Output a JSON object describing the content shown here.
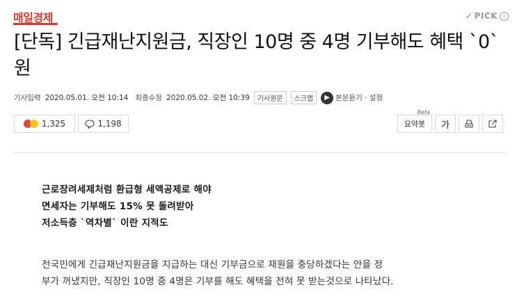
{
  "press": {
    "logo": "매일경제"
  },
  "pick": {
    "label": "PICK",
    "check": "✓",
    "info": "i"
  },
  "article": {
    "title": "[단독] 긴급재난지원금, 직장인 10명 중 4명 기부해도 혜택 `0`원",
    "meta": {
      "published_label": "기사입력",
      "published": "2020.05.01. 오전 10:14",
      "modified_label": "최종수정",
      "modified": "2020.05.02. 오전 10:39",
      "original_link": "기사원문",
      "scrap": "스크랩",
      "audio_label": "본문듣기 · 설정"
    },
    "reactions": {
      "count": "1,325"
    },
    "comments": {
      "count": "1,198"
    },
    "tools": {
      "summary": "요약봇",
      "summary_beta": "Beta",
      "font": "가"
    },
    "subheads": [
      "근로장려세제처럼 환급형 세액공제로 해야",
      "면세자는 기부해도 15% 못 돌려받아",
      "저소득층 `역차별` 이란 지적도"
    ],
    "body": [
      "전국민에게 긴급재난지원금을 지급하는 대신 기부금으로 재원을 충당하겠다는 안을 정",
      "부가 꺼냈지만, 직장인 10명 중 4명은 기부를 해도 혜택을 전혀 못 받는것으로 나타났다."
    ]
  },
  "colors": {
    "brand": "#d43b2f"
  }
}
